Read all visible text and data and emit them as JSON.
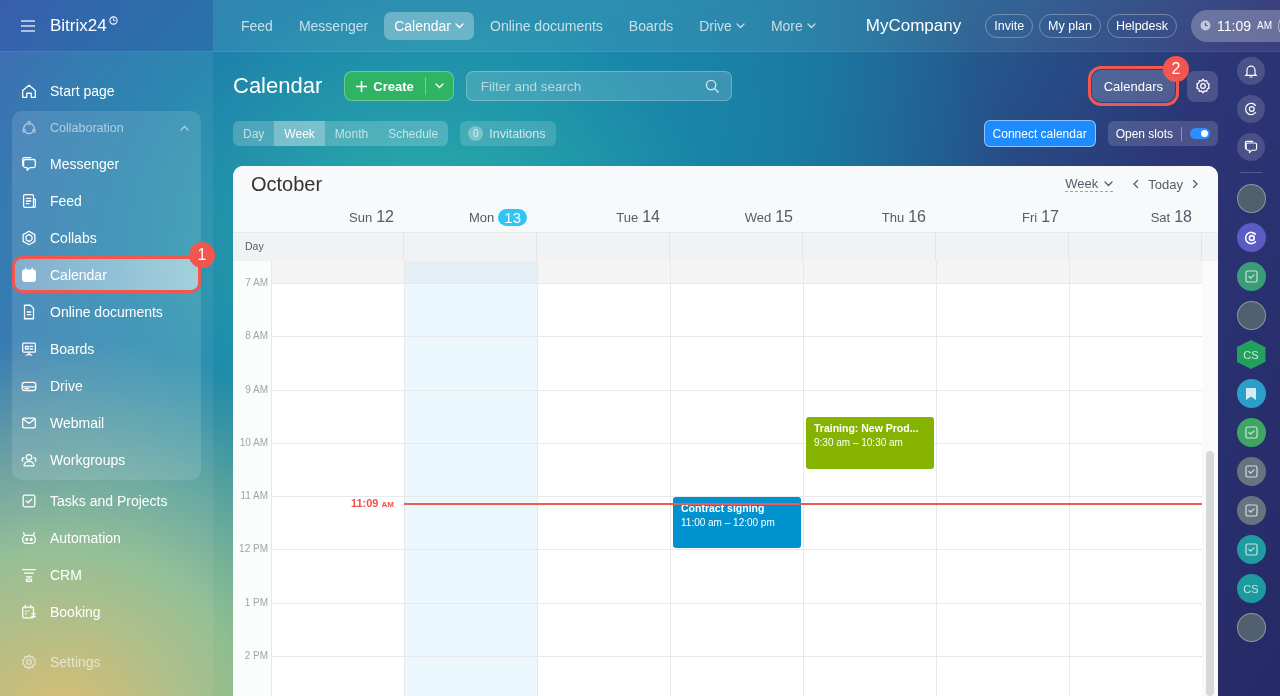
{
  "header": {
    "logo": "Bitrix24",
    "nav": [
      {
        "label": "Feed",
        "selected": false,
        "dropdown": false
      },
      {
        "label": "Messenger",
        "selected": false,
        "dropdown": false
      },
      {
        "label": "Calendar",
        "selected": true,
        "dropdown": true
      },
      {
        "label": "Online documents",
        "selected": false,
        "dropdown": false
      },
      {
        "label": "Boards",
        "selected": false,
        "dropdown": false
      },
      {
        "label": "Drive",
        "selected": false,
        "dropdown": true
      },
      {
        "label": "More",
        "selected": false,
        "dropdown": true
      }
    ],
    "company": "MyCompany",
    "buttons": [
      "Invite",
      "My plan",
      "Helpdesk"
    ],
    "clock": {
      "time": "11:09",
      "suffix": "AM"
    }
  },
  "sidebar": {
    "items": [
      {
        "kind": "item",
        "label": "Start page",
        "selected": false
      },
      {
        "kind": "group",
        "label": "Collaboration",
        "expanded": true,
        "children": [
          {
            "label": "Messenger",
            "selected": false
          },
          {
            "label": "Feed",
            "selected": false
          },
          {
            "label": "Collabs",
            "selected": false
          },
          {
            "label": "Calendar",
            "selected": true,
            "callout": "1"
          },
          {
            "label": "Online documents",
            "selected": false
          },
          {
            "label": "Boards",
            "selected": false
          },
          {
            "label": "Drive",
            "selected": false
          },
          {
            "label": "Webmail",
            "selected": false
          },
          {
            "label": "Workgroups",
            "selected": false
          }
        ]
      },
      {
        "kind": "item",
        "label": "Tasks and Projects",
        "selected": false
      },
      {
        "kind": "item",
        "label": "Automation",
        "selected": false
      },
      {
        "kind": "item",
        "label": "CRM",
        "selected": false
      },
      {
        "kind": "item",
        "label": "Booking",
        "selected": false
      }
    ],
    "settings": "Settings"
  },
  "toolbar": {
    "title": "Calendar",
    "create": "Create",
    "search": {
      "placeholder": "Filter and search"
    },
    "calendars": {
      "label": "Calendars",
      "callout": "2"
    },
    "views": [
      {
        "label": "Day",
        "selected": false
      },
      {
        "label": "Week",
        "selected": true
      },
      {
        "label": "Month",
        "selected": false
      },
      {
        "label": "Schedule",
        "selected": false
      }
    ],
    "invitations": {
      "count": "0",
      "label": "Invitations"
    },
    "connect": "Connect calendar",
    "open_slots": {
      "label": "Open slots",
      "on": true
    }
  },
  "calendar": {
    "month": "October",
    "view": "Week",
    "today_button": "Today",
    "all_day": "Day",
    "days": [
      {
        "weekday": "Sun",
        "date": "12",
        "today": false
      },
      {
        "weekday": "Mon",
        "date": "13",
        "today": true
      },
      {
        "weekday": "Tue",
        "date": "14",
        "today": false
      },
      {
        "weekday": "Wed",
        "date": "15",
        "today": false,
        "events": [
          {
            "title": "Contract signing",
            "time": "11:00 am – 12:00 pm",
            "color": "#0091cf"
          }
        ]
      },
      {
        "weekday": "Thu",
        "date": "16",
        "today": false,
        "events": [
          {
            "title": "Training: New Prod...",
            "time": "9:30 am – 10:30 am",
            "color": "#86b300"
          }
        ]
      },
      {
        "weekday": "Fri",
        "date": "17",
        "today": false
      },
      {
        "weekday": "Sat",
        "date": "18",
        "today": false
      }
    ],
    "hours": [
      "7 AM",
      "8 AM",
      "9 AM",
      "10 AM",
      "11 AM",
      "12 PM",
      "1 PM",
      "2 PM"
    ],
    "now": {
      "time": "11:09",
      "suffix": "AM"
    }
  },
  "rail": [
    {
      "kind": "avatar"
    },
    {
      "kind": "app",
      "color": "#5b5bc4"
    },
    {
      "kind": "task",
      "color": "#3b9c78"
    },
    {
      "kind": "avatar"
    },
    {
      "kind": "hexagon",
      "text": "CS",
      "color": "#22a05e"
    },
    {
      "kind": "bookmark",
      "color": "#2a9fc9"
    },
    {
      "kind": "task",
      "color": "#3ea564"
    },
    {
      "kind": "task",
      "color": "#657580"
    },
    {
      "kind": "task",
      "color": "#657580"
    },
    {
      "kind": "task",
      "color": "#1f9ca0"
    },
    {
      "kind": "text",
      "text": "CS",
      "color": "#1d9aa0"
    },
    {
      "kind": "avatar"
    }
  ]
}
